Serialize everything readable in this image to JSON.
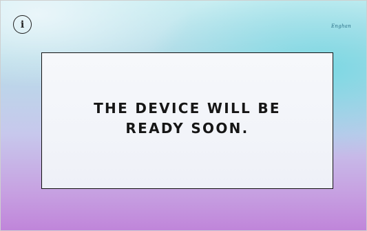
{
  "header": {
    "info_icon": "info-icon",
    "info_glyph": "i",
    "brand_logo_text": "Enghan"
  },
  "panel": {
    "message": "THE DEVICE WILL BE READY SOON."
  },
  "colors": {
    "panel_border": "#111111",
    "text": "#161616",
    "gradient_top": "#c9eef2",
    "gradient_bottom": "#c085da"
  }
}
